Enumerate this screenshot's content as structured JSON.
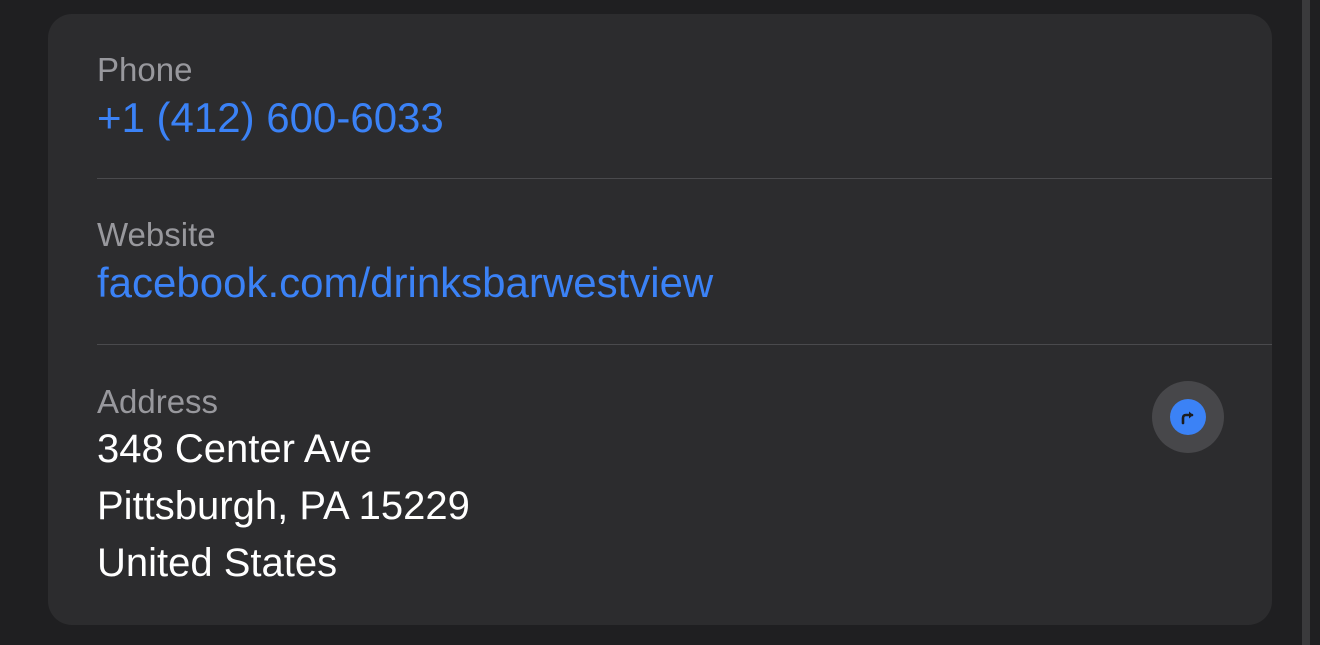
{
  "phone": {
    "label": "Phone",
    "value": "+1 (412) 600-6033"
  },
  "website": {
    "label": "Website",
    "value": "facebook.com/drinksbarwestview"
  },
  "address": {
    "label": "Address",
    "lines": [
      "348 Center Ave",
      "Pittsburgh, PA 15229",
      "United States"
    ],
    "action_icon": "directions-icon"
  },
  "colors": {
    "link": "#3b82f6",
    "label": "#98989d",
    "card_background": "#2c2c2e",
    "page_background": "#1f1f21"
  }
}
